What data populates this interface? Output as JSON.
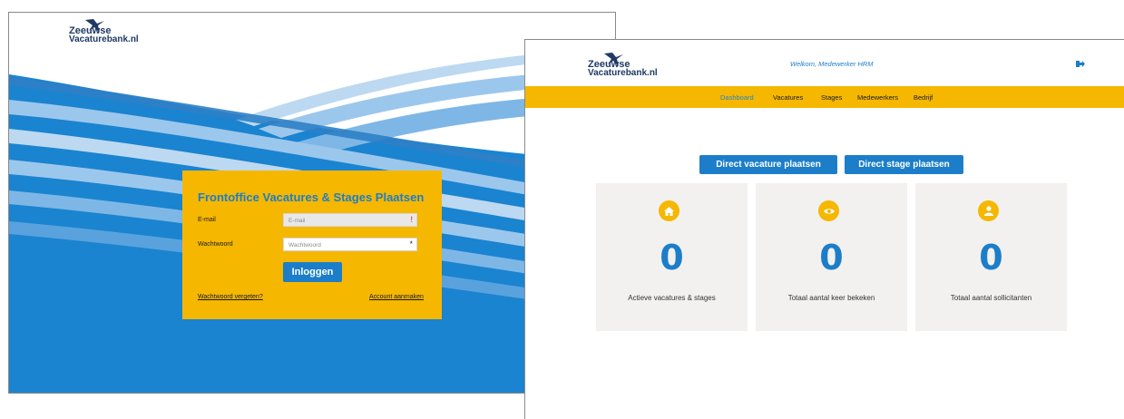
{
  "login": {
    "logo": {
      "line1": "Zeeuwse",
      "line2": "Vacaturebank.nl"
    },
    "title": "Frontoffice Vacatures & Stages Plaatsen",
    "email_label": "E-mail",
    "email_placeholder": "E-mail",
    "email_required_mark": "!",
    "password_label": "Wachtwoord",
    "password_placeholder": "Wachtwoord",
    "password_required_mark": "*",
    "login_button": "Inloggen",
    "forgot_link": "Wachtwoord vergeten?",
    "create_account_link": "Account aanmaken"
  },
  "dashboard": {
    "logo": {
      "line1": "Zeeuwse",
      "line2": "Vacaturebank.nl"
    },
    "welcome": "Welkom, Medewerker HRM",
    "nav": [
      "Dashboard",
      "Vacatures",
      "Stages",
      "Medewerkers",
      "Bedrijf"
    ],
    "active_nav": "Dashboard",
    "cta_vacature": "Direct vacature plaatsen",
    "cta_stage": "Direct stage plaatsen",
    "cards": [
      {
        "icon": "home-icon",
        "value": "0",
        "caption": "Actieve vacatures & stages"
      },
      {
        "icon": "eye-icon",
        "value": "0",
        "caption": "Totaal aantal keer bekeken"
      },
      {
        "icon": "user-icon",
        "value": "0",
        "caption": "Totaal aantal sollicitanten"
      }
    ]
  },
  "colors": {
    "brand_blue": "#1c7ec9",
    "accent_yellow": "#f5b700",
    "card_bg": "#f2f1ef",
    "logo_navy": "#1f3a63"
  }
}
